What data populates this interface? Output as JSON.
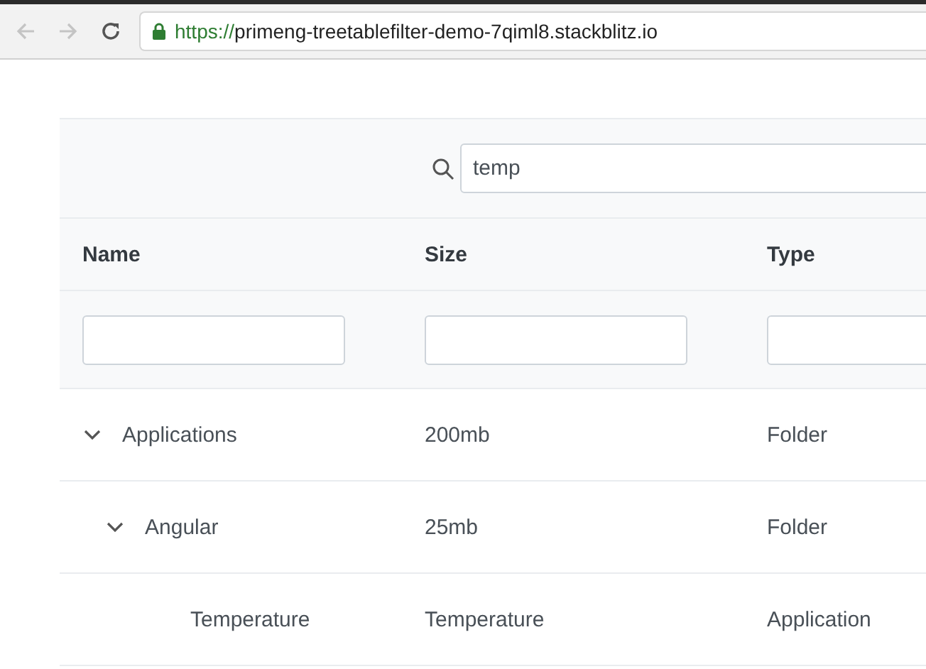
{
  "browser": {
    "url_scheme": "https://",
    "url_host": "primeng-treetablefilter-demo-7qiml8.stackblitz.io",
    "back_disabled": true,
    "forward_disabled": true
  },
  "global_filter": {
    "value": "temp"
  },
  "table": {
    "columns": [
      "Name",
      "Size",
      "Type"
    ],
    "rows": [
      {
        "name": "Applications",
        "size": "200mb",
        "type": "Folder",
        "expanded": true,
        "children": [
          {
            "name": "Angular",
            "size": "25mb",
            "type": "Folder",
            "expanded": true,
            "children": [
              {
                "name": "Temperature",
                "size": "Temperature",
                "type": "Application"
              }
            ]
          }
        ]
      }
    ]
  }
}
